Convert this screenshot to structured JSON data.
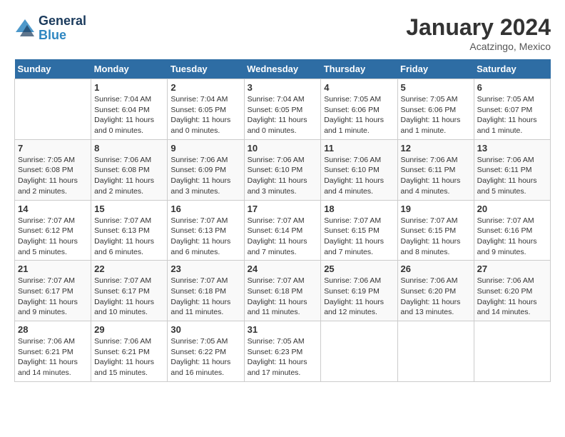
{
  "logo": {
    "line1": "General",
    "line2": "Blue"
  },
  "title": "January 2024",
  "subtitle": "Acatzingo, Mexico",
  "days_header": [
    "Sunday",
    "Monday",
    "Tuesday",
    "Wednesday",
    "Thursday",
    "Friday",
    "Saturday"
  ],
  "weeks": [
    [
      {
        "num": "",
        "info": ""
      },
      {
        "num": "1",
        "info": "Sunrise: 7:04 AM\nSunset: 6:04 PM\nDaylight: 11 hours\nand 0 minutes."
      },
      {
        "num": "2",
        "info": "Sunrise: 7:04 AM\nSunset: 6:05 PM\nDaylight: 11 hours\nand 0 minutes."
      },
      {
        "num": "3",
        "info": "Sunrise: 7:04 AM\nSunset: 6:05 PM\nDaylight: 11 hours\nand 0 minutes."
      },
      {
        "num": "4",
        "info": "Sunrise: 7:05 AM\nSunset: 6:06 PM\nDaylight: 11 hours\nand 1 minute."
      },
      {
        "num": "5",
        "info": "Sunrise: 7:05 AM\nSunset: 6:06 PM\nDaylight: 11 hours\nand 1 minute."
      },
      {
        "num": "6",
        "info": "Sunrise: 7:05 AM\nSunset: 6:07 PM\nDaylight: 11 hours\nand 1 minute."
      }
    ],
    [
      {
        "num": "7",
        "info": "Sunrise: 7:05 AM\nSunset: 6:08 PM\nDaylight: 11 hours\nand 2 minutes."
      },
      {
        "num": "8",
        "info": "Sunrise: 7:06 AM\nSunset: 6:08 PM\nDaylight: 11 hours\nand 2 minutes."
      },
      {
        "num": "9",
        "info": "Sunrise: 7:06 AM\nSunset: 6:09 PM\nDaylight: 11 hours\nand 3 minutes."
      },
      {
        "num": "10",
        "info": "Sunrise: 7:06 AM\nSunset: 6:10 PM\nDaylight: 11 hours\nand 3 minutes."
      },
      {
        "num": "11",
        "info": "Sunrise: 7:06 AM\nSunset: 6:10 PM\nDaylight: 11 hours\nand 4 minutes."
      },
      {
        "num": "12",
        "info": "Sunrise: 7:06 AM\nSunset: 6:11 PM\nDaylight: 11 hours\nand 4 minutes."
      },
      {
        "num": "13",
        "info": "Sunrise: 7:06 AM\nSunset: 6:11 PM\nDaylight: 11 hours\nand 5 minutes."
      }
    ],
    [
      {
        "num": "14",
        "info": "Sunrise: 7:07 AM\nSunset: 6:12 PM\nDaylight: 11 hours\nand 5 minutes."
      },
      {
        "num": "15",
        "info": "Sunrise: 7:07 AM\nSunset: 6:13 PM\nDaylight: 11 hours\nand 6 minutes."
      },
      {
        "num": "16",
        "info": "Sunrise: 7:07 AM\nSunset: 6:13 PM\nDaylight: 11 hours\nand 6 minutes."
      },
      {
        "num": "17",
        "info": "Sunrise: 7:07 AM\nSunset: 6:14 PM\nDaylight: 11 hours\nand 7 minutes."
      },
      {
        "num": "18",
        "info": "Sunrise: 7:07 AM\nSunset: 6:15 PM\nDaylight: 11 hours\nand 7 minutes."
      },
      {
        "num": "19",
        "info": "Sunrise: 7:07 AM\nSunset: 6:15 PM\nDaylight: 11 hours\nand 8 minutes."
      },
      {
        "num": "20",
        "info": "Sunrise: 7:07 AM\nSunset: 6:16 PM\nDaylight: 11 hours\nand 9 minutes."
      }
    ],
    [
      {
        "num": "21",
        "info": "Sunrise: 7:07 AM\nSunset: 6:17 PM\nDaylight: 11 hours\nand 9 minutes."
      },
      {
        "num": "22",
        "info": "Sunrise: 7:07 AM\nSunset: 6:17 PM\nDaylight: 11 hours\nand 10 minutes."
      },
      {
        "num": "23",
        "info": "Sunrise: 7:07 AM\nSunset: 6:18 PM\nDaylight: 11 hours\nand 11 minutes."
      },
      {
        "num": "24",
        "info": "Sunrise: 7:07 AM\nSunset: 6:18 PM\nDaylight: 11 hours\nand 11 minutes."
      },
      {
        "num": "25",
        "info": "Sunrise: 7:06 AM\nSunset: 6:19 PM\nDaylight: 11 hours\nand 12 minutes."
      },
      {
        "num": "26",
        "info": "Sunrise: 7:06 AM\nSunset: 6:20 PM\nDaylight: 11 hours\nand 13 minutes."
      },
      {
        "num": "27",
        "info": "Sunrise: 7:06 AM\nSunset: 6:20 PM\nDaylight: 11 hours\nand 14 minutes."
      }
    ],
    [
      {
        "num": "28",
        "info": "Sunrise: 7:06 AM\nSunset: 6:21 PM\nDaylight: 11 hours\nand 14 minutes."
      },
      {
        "num": "29",
        "info": "Sunrise: 7:06 AM\nSunset: 6:21 PM\nDaylight: 11 hours\nand 15 minutes."
      },
      {
        "num": "30",
        "info": "Sunrise: 7:05 AM\nSunset: 6:22 PM\nDaylight: 11 hours\nand 16 minutes."
      },
      {
        "num": "31",
        "info": "Sunrise: 7:05 AM\nSunset: 6:23 PM\nDaylight: 11 hours\nand 17 minutes."
      },
      {
        "num": "",
        "info": ""
      },
      {
        "num": "",
        "info": ""
      },
      {
        "num": "",
        "info": ""
      }
    ]
  ]
}
